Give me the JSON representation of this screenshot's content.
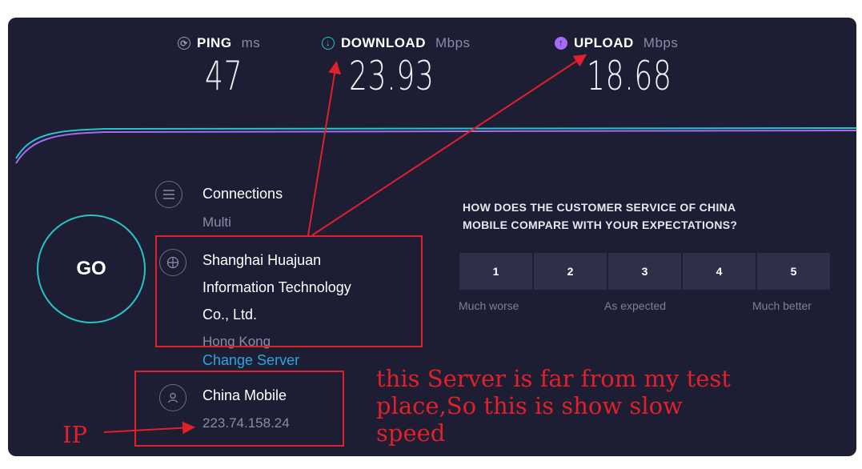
{
  "metrics": {
    "ping": {
      "label": "PING",
      "unit": "ms",
      "value": "47",
      "icon": "ping-icon",
      "color": "#ffffff"
    },
    "download": {
      "label": "DOWNLOAD",
      "unit": "Mbps",
      "value": "23.93",
      "icon": "download-icon",
      "color": "#26c3c9"
    },
    "upload": {
      "label": "UPLOAD",
      "unit": "Mbps",
      "value": "18.68",
      "icon": "upload-icon",
      "color": "#a56bf5"
    }
  },
  "go_label": "GO",
  "connections": {
    "title": "Connections",
    "mode": "Multi"
  },
  "server": {
    "line1": "Shanghai Huajuan",
    "line2": "Information Technology",
    "line3": "Co., Ltd.",
    "location": "Hong Kong",
    "change_label": "Change Server"
  },
  "isp": {
    "name": "China Mobile",
    "ip": "223.74.158.24"
  },
  "survey": {
    "question_line1": "HOW DOES THE CUSTOMER SERVICE OF CHINA",
    "question_line2": "MOBILE COMPARE WITH YOUR EXPECTATIONS?",
    "options": [
      "1",
      "2",
      "3",
      "4",
      "5"
    ],
    "label_low": "Much worse",
    "label_mid": "As expected",
    "label_high": "Much better"
  },
  "annotations": {
    "ip_label": "IP",
    "note_line1": "this Server is far from my test",
    "note_line2": "place,So this is show slow",
    "note_line3": "speed"
  },
  "colors": {
    "background": "#1d1d33",
    "accent_download": "#26c3c9",
    "accent_upload": "#a56bf5",
    "annotation_red": "#e0202a",
    "link": "#2ba6e0"
  }
}
